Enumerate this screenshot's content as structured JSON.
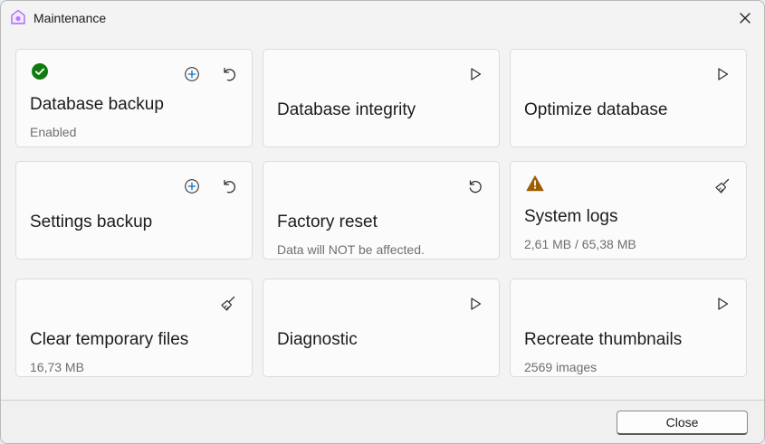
{
  "window": {
    "title": "Maintenance"
  },
  "cards": {
    "database_backup": {
      "title": "Database backup",
      "subtitle": "Enabled"
    },
    "database_integrity": {
      "title": "Database integrity"
    },
    "optimize_database": {
      "title": "Optimize database"
    },
    "settings_backup": {
      "title": "Settings backup"
    },
    "factory_reset": {
      "title": "Factory reset",
      "subtitle": "Data will NOT be affected."
    },
    "system_logs": {
      "title": "System logs",
      "subtitle": "2,61 MB / 65,38 MB"
    },
    "clear_temporary_files": {
      "title": "Clear temporary files",
      "subtitle": "16,73 MB"
    },
    "diagnostic": {
      "title": "Diagnostic"
    },
    "recreate_thumbnails": {
      "title": "Recreate thumbnails",
      "subtitle": "2569 images"
    }
  },
  "footer": {
    "close_label": "Close"
  },
  "icons": [
    "app-icon",
    "close-icon",
    "check-icon",
    "add-icon",
    "undo-icon",
    "play-icon",
    "reset-icon",
    "warning-icon",
    "broom-icon"
  ],
  "colors": {
    "success": "#107c10",
    "warning": "#9d5d00",
    "accent": "#0f6cbd",
    "app_icon": "#b27cff"
  }
}
